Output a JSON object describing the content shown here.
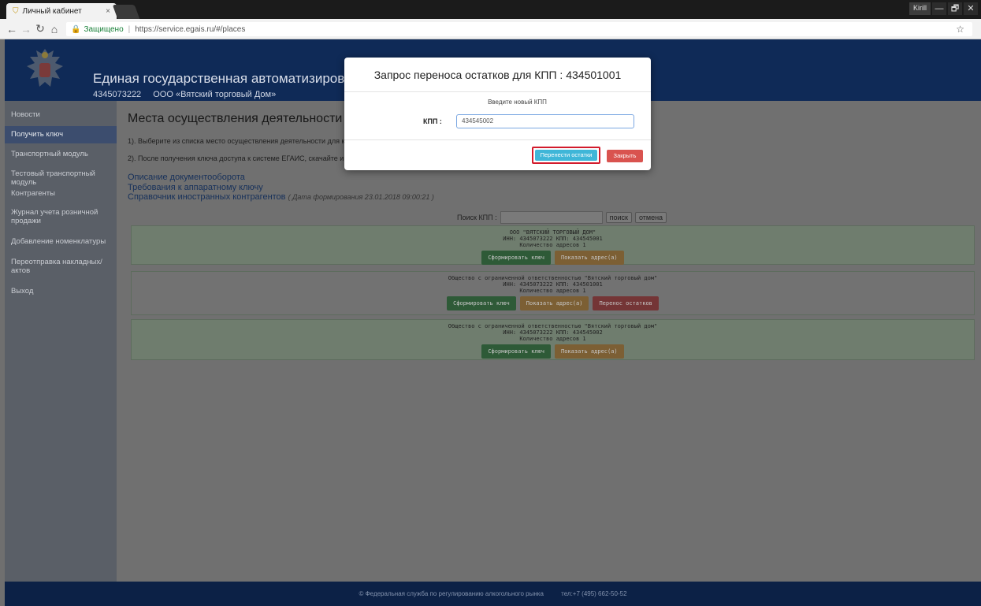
{
  "browser": {
    "tab_title": "Личный кабинет",
    "tab_close": "×",
    "user_label": "Kirill",
    "win_min": "—",
    "win_max": "🗗",
    "win_close": "✕",
    "secure_label": "Защищено",
    "url": "https://service.egais.ru/#/places"
  },
  "header": {
    "title": "Единая государственная автоматизированная инф",
    "inn": "4345073222",
    "org_name": "ООО «Вятский торговый Дом»"
  },
  "sidebar": {
    "items": [
      {
        "label": "Новости",
        "active": false
      },
      {
        "label": "Получить ключ",
        "active": true
      },
      {
        "label": "Транспортный модуль",
        "active": false
      },
      {
        "label": "Тестовый транспортный модуль",
        "active": false
      },
      {
        "label": "Контрагенты",
        "active": false
      },
      {
        "label": "Журнал учета розничной продажи",
        "active": false
      },
      {
        "label": "Добавление номенклатуры",
        "active": false
      },
      {
        "label": "Переотправка накладных/актов",
        "active": false
      },
      {
        "label": "Выход",
        "active": false
      }
    ]
  },
  "main": {
    "title": "Места осуществления деятельности",
    "step1": "1). Выберите из списка место осуществления деятельности для которого н",
    "step2": "2). После получения ключа доступа к системе ЕГАИС, скачайте и установит",
    "links": {
      "doc_flow": "Описание документооборота",
      "hw_key": "Требования к аппаратному ключу",
      "foreign": "Справочник иностранных контрагентов",
      "foreign_date": "( Дата формирования 23.01.2018 09:00:21 )"
    },
    "search": {
      "label": "Поиск КПП :",
      "value": "",
      "search_btn": "поиск",
      "cancel_btn": "отмена"
    },
    "orgs": [
      {
        "name": "ООО \"ВЯТСКИЙ ТОРГОВЫЙ ДОМ\"",
        "ids": "ИНН: 4345073222 КПП: 434545001",
        "count": "Количество адресов 1",
        "btn_key": "Сформировать ключ",
        "btn_addr": "Показать адрес(а)",
        "btn_move": ""
      },
      {
        "name": "Общество с ограниченной ответственностью \"Вятский торговый дом\"",
        "ids": "ИНН: 4345073222 КПП: 434501001",
        "count": "Количество адресов 1",
        "btn_key": "Сформировать ключ",
        "btn_addr": "Показать адрес(а)",
        "btn_move": "Перенос остатков"
      },
      {
        "name": "Общество с ограниченной ответственностью \"Вятский торговый дом\"",
        "ids": "ИНН: 4345073222 КПП: 434545002",
        "count": "Количество адресов 1",
        "btn_key": "Сформировать ключ",
        "btn_addr": "Показать адрес(а)",
        "btn_move": ""
      }
    ]
  },
  "footer": {
    "copyright": "© Федеральная служба по регулированию алкогольного рынка",
    "phone": "тел:+7 (495) 662-50-52"
  },
  "modal": {
    "title": "Запрос переноса остатков для КПП : 434501001",
    "hint": "Введите новый КПП",
    "kpp_label": "КПП :",
    "kpp_value": "434545002",
    "transfer_btn": "Перенести остатки",
    "close_btn": "Закрыть"
  }
}
